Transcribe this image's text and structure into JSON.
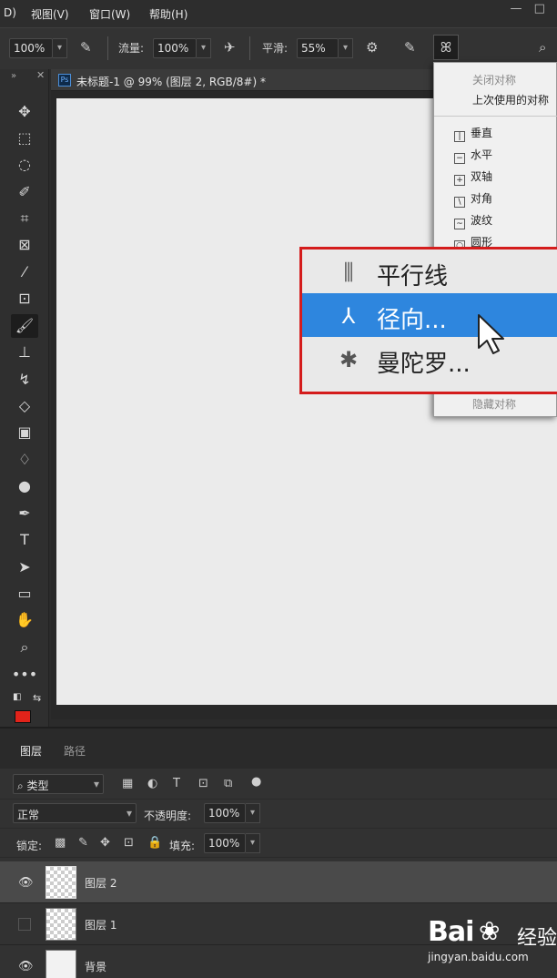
{
  "menubar": {
    "items": [
      "D)",
      "视图(V)",
      "窗口(W)",
      "帮助(H)"
    ],
    "window_controls": [
      "—",
      "□"
    ]
  },
  "options": {
    "size_value": "100%",
    "flow_label": "流量:",
    "flow_value": "100%",
    "smooth_label": "平滑:",
    "smooth_value": "55%"
  },
  "document": {
    "ps_badge": "Ps",
    "title": "未标题-1 @ 99% (图层 2, RGB/8#) *"
  },
  "symmetry_menu": {
    "close_label": "关闭对称",
    "last_used_label": "上次使用的对称",
    "items": [
      {
        "icon": "vertical-icon",
        "label": "垂直"
      },
      {
        "icon": "horizontal-icon",
        "label": "水平"
      },
      {
        "icon": "dual-axis-icon",
        "label": "双轴"
      },
      {
        "icon": "diagonal-icon",
        "label": "对角"
      },
      {
        "icon": "wavy-icon",
        "label": "波纹"
      },
      {
        "icon": "circle-icon",
        "label": "圆形"
      }
    ],
    "hide_label": "隐藏对称"
  },
  "callout": {
    "items": [
      {
        "icon": "parallel-lines-icon",
        "label": "平行线",
        "selected": false
      },
      {
        "icon": "radial-icon",
        "label": "径向...",
        "selected": true
      },
      {
        "icon": "mandala-icon",
        "label": "曼陀罗...",
        "selected": false
      }
    ]
  },
  "layers_panel": {
    "tabs": [
      "图层",
      "路径"
    ],
    "filter_label": "类型",
    "blend_mode": "正常",
    "opacity_label": "不透明度:",
    "opacity_value": "100%",
    "lock_label": "锁定:",
    "fill_label": "填充:",
    "fill_value": "100%",
    "layers": [
      {
        "name": "图层 2",
        "visible": true,
        "selected": true
      },
      {
        "name": "图层 1",
        "visible": false,
        "selected": false
      },
      {
        "name": "背景",
        "visible": true,
        "selected": false
      }
    ]
  },
  "watermark": {
    "logo": "Bai",
    "logo_suffix": "经验",
    "url": "jingyan.baidu.com"
  },
  "colors": {
    "foreground": "#e2231a",
    "highlight": "#2e86de",
    "callout_border": "#d41c1c"
  }
}
